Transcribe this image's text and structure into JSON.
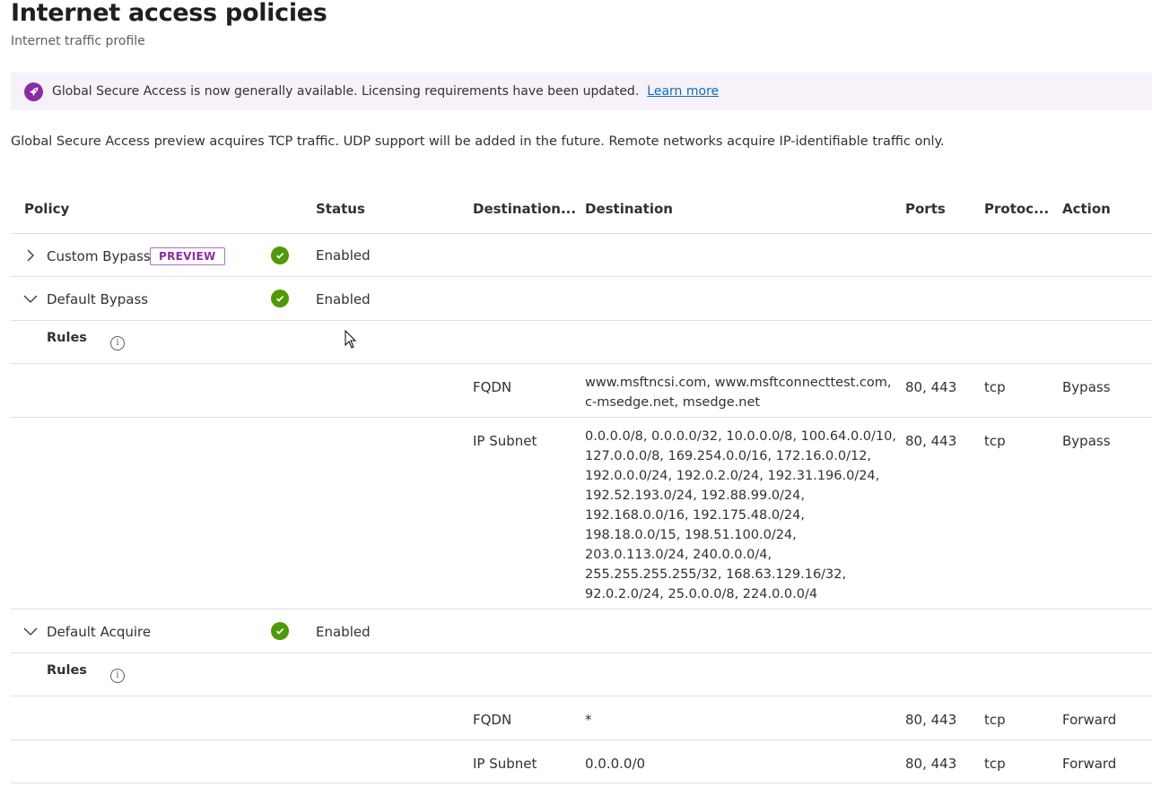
{
  "page": {
    "title": "Internet access policies",
    "subtitle": "Internet traffic profile"
  },
  "banner": {
    "icon": "rocket-icon",
    "text": "Global Secure Access is now generally available. Licensing requirements have been updated.",
    "link": "Learn more",
    "color": "#8a2da5"
  },
  "info_text": "Global Secure Access preview acquires TCP traffic. UDP support will be added in the future. Remote networks acquire IP-identifiable traffic only.",
  "table": {
    "headers": {
      "policy": "Policy",
      "status": "Status",
      "destination_type": "Destination...",
      "destination": "Destination",
      "ports": "Ports",
      "protocol": "Protoc...",
      "action": "Action"
    },
    "policies": [
      {
        "name": "Custom Bypass",
        "badge": "PREVIEW",
        "status": "Enabled",
        "expanded": false
      },
      {
        "name": "Default Bypass",
        "status": "Enabled",
        "expanded": true
      },
      {
        "name": "Default Acquire",
        "status": "Enabled",
        "expanded": true
      }
    ],
    "rules_label": "Rules",
    "default_bypass_rules": [
      {
        "type": "FQDN",
        "destination": "www.msftncsi.com, www.msftconnecttest.com,\nc-msedge.net, msedge.net",
        "ports": "80, 443",
        "protocol": "tcp",
        "action": "Bypass"
      },
      {
        "type": "IP Subnet",
        "destination": "0.0.0.0/8, 0.0.0.0/32, 10.0.0.0/8, 100.64.0.0/10,\n127.0.0.0/8, 169.254.0.0/16, 172.16.0.0/12,\n192.0.0.0/24, 192.0.2.0/24, 192.31.196.0/24,\n192.52.193.0/24, 192.88.99.0/24,\n192.168.0.0/16, 192.175.48.0/24,\n198.18.0.0/15, 198.51.100.0/24,\n203.0.113.0/24, 240.0.0.0/4,\n255.255.255.255/32, 168.63.129.16/32,\n92.0.2.0/24, 25.0.0.0/8, 224.0.0.0/4",
        "ports": "80, 443",
        "protocol": "tcp",
        "action": "Bypass"
      }
    ],
    "default_acquire_rules": [
      {
        "type": "FQDN",
        "destination": "*",
        "ports": "80, 443",
        "protocol": "tcp",
        "action": "Forward"
      },
      {
        "type": "IP Subnet",
        "destination": "0.0.0.0/0",
        "ports": "80, 443",
        "protocol": "tcp",
        "action": "Forward"
      }
    ]
  },
  "colors": {
    "enabled": "#4e9a06",
    "link": "#0f6cbd",
    "preview": "#8a2da5"
  }
}
